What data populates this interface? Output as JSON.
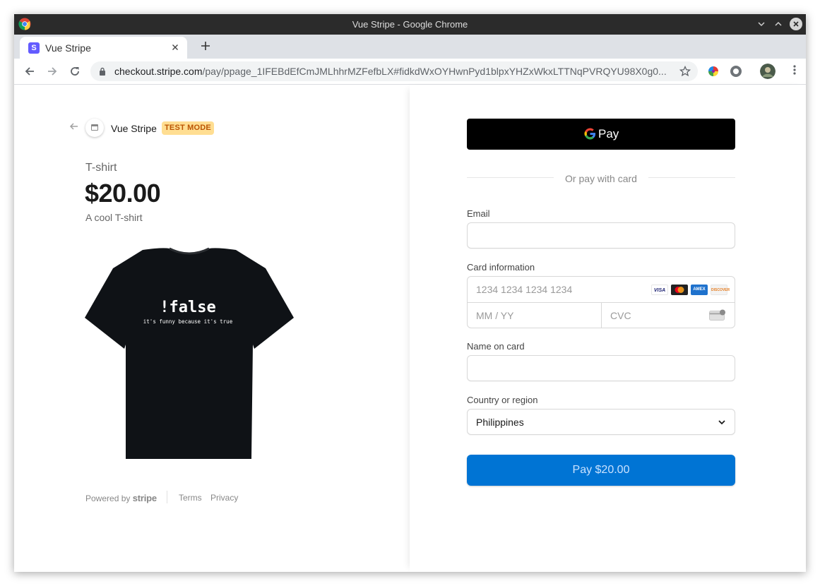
{
  "window": {
    "title": "Vue Stripe - Google Chrome"
  },
  "browser": {
    "tab_title": "Vue Stripe",
    "tab_favicon_letter": "S",
    "url_host": "checkout.stripe.com",
    "url_path": "/pay/ppage_1IFEBdEfCmJMLhhrMZFefbLX#fidkdWxOYHwnPyd1blpxYHZxWkxLTTNqPVRQYU98X0g0..."
  },
  "merchant": {
    "name": "Vue Stripe",
    "badge": "TEST MODE"
  },
  "product": {
    "name": "T-shirt",
    "price": "$20.00",
    "description": "A cool T-shirt",
    "shirt_text_main": "!false",
    "shirt_text_sub": "it's funny because it's true"
  },
  "footer": {
    "powered_by": "Powered by",
    "stripe": "stripe",
    "terms": "Terms",
    "privacy": "Privacy"
  },
  "form": {
    "gpay_label": "Pay",
    "divider": "Or pay with card",
    "email_label": "Email",
    "card_label": "Card information",
    "card_number_placeholder": "1234 1234 1234 1234",
    "expiry_placeholder": "MM / YY",
    "cvc_placeholder": "CVC",
    "card_brands": [
      "VISA",
      "MC",
      "AMEX",
      "DISCOVER"
    ],
    "name_label": "Name on card",
    "country_label": "Country or region",
    "country_value": "Philippines",
    "pay_button": "Pay $20.00"
  },
  "colors": {
    "pay_button": "#0074d4",
    "test_badge_bg": "#ffde92",
    "test_badge_text": "#bb5504",
    "gpay_bg": "#000000"
  }
}
